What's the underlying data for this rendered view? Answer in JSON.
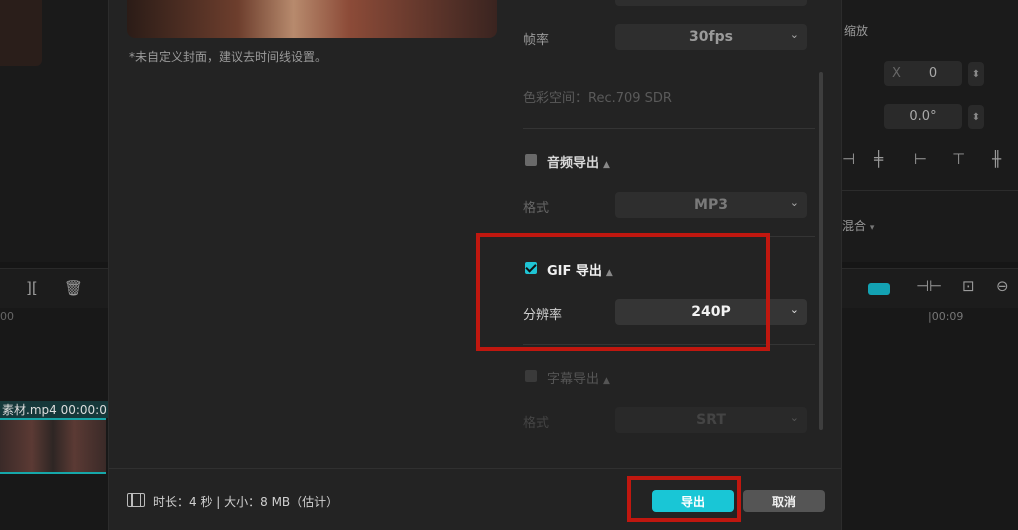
{
  "background": {
    "right_panel": {
      "scale_label": "缩放",
      "x_label": "X",
      "x_value": "0",
      "rotation_value": "0.0°",
      "blend_label": "混合"
    },
    "timeline": {
      "clip_label": "素材.mp4  00:00:0",
      "time_mark_left": "00",
      "time_mark_right": "|00:09"
    }
  },
  "dialog": {
    "cover_note": "*未自定义封面，建议去时间线设置。",
    "video": {
      "framerate_label": "帧率",
      "framerate_value": "30fps",
      "colorspace_label": "色彩空间：Rec.709 SDR"
    },
    "audio": {
      "title": "音频导出",
      "checked": false,
      "format_label": "格式",
      "format_value": "MP3"
    },
    "gif": {
      "title": "GIF 导出",
      "checked": true,
      "resolution_label": "分辨率",
      "resolution_value": "240P"
    },
    "subtitle": {
      "title": "字幕导出",
      "checked": false,
      "format_label": "格式",
      "format_value": "SRT"
    },
    "footer": {
      "info": "时长：4 秒 | 大小：8 MB（估计）",
      "export_label": "导出",
      "cancel_label": "取消"
    }
  },
  "colors": {
    "accent": "#19c6d6",
    "highlight": "#c0170f"
  }
}
